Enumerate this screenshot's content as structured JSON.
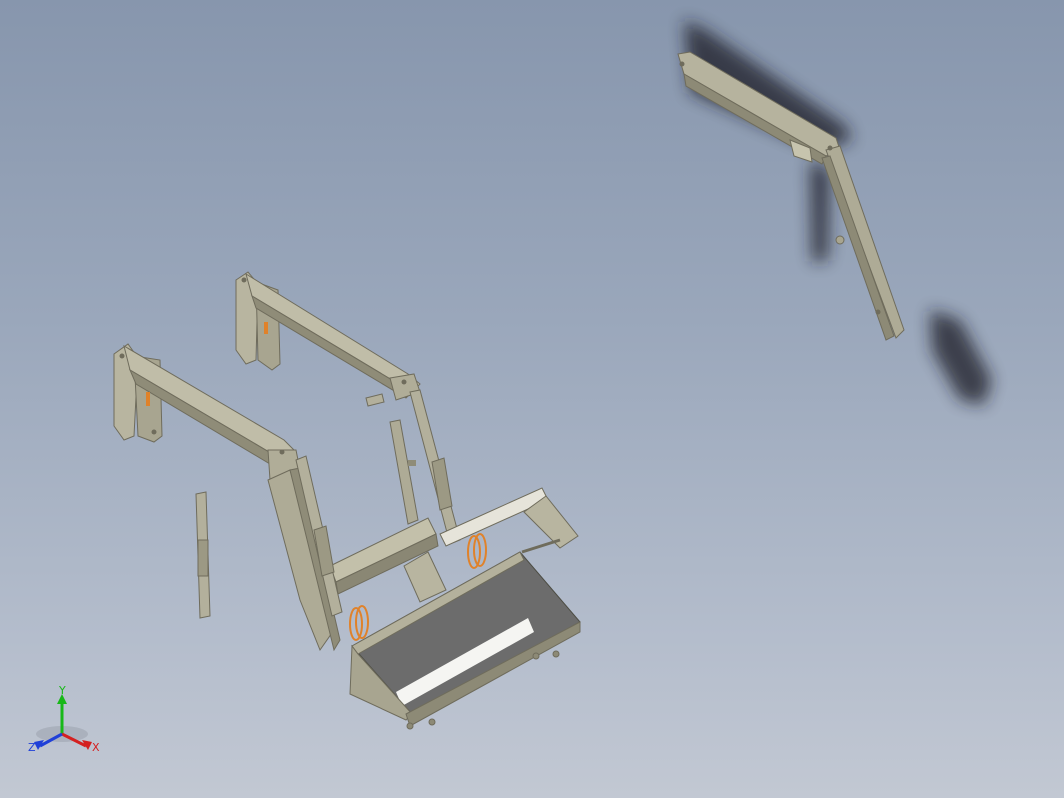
{
  "viewport": {
    "background_top": "#8796ad",
    "background_bottom": "#c2c8d3"
  },
  "model": {
    "parts": [
      "loader-frame-left",
      "loader-frame-right",
      "cross-tube",
      "lift-cylinder-left",
      "lift-cylinder-right",
      "spare-cylinder",
      "crossmember",
      "bucket",
      "bucket-bracket",
      "separate-boom-arm"
    ],
    "colors": {
      "steel": "#a8a590",
      "steel_dark": "#7d7a68",
      "steel_light": "#cbc8b4",
      "spring": "#e0822a",
      "bucket_inside": "#6c6c6c",
      "shadow": "#1b1f26"
    }
  },
  "triad": {
    "x_label": "X",
    "y_label": "Y",
    "z_label": "Z",
    "x_color": "#d42020",
    "y_color": "#18b818",
    "z_color": "#2040d8"
  }
}
